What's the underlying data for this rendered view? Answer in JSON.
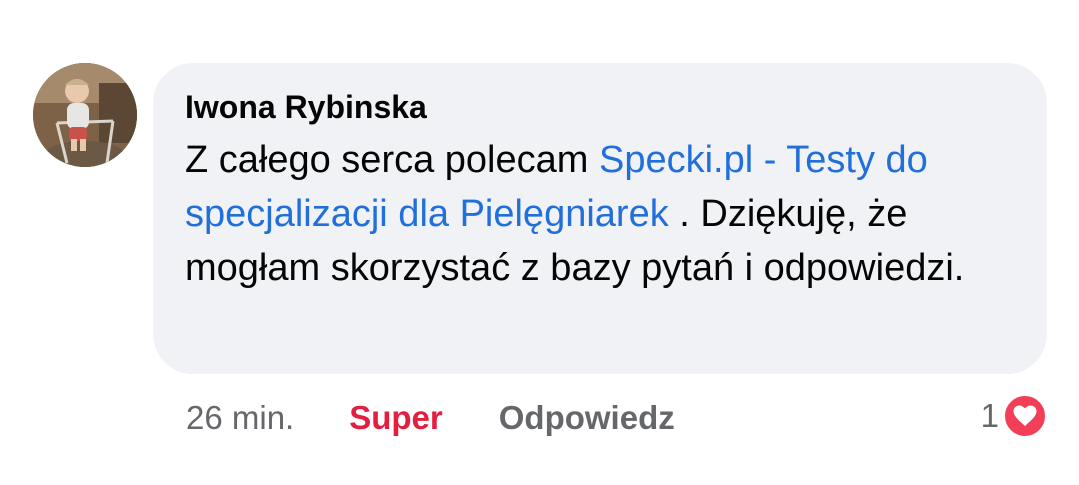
{
  "comment": {
    "author": "Iwona Rybinska",
    "text_before_link": "Z całego serca polecam ",
    "link_text": "Specki.pl - Testy do specjalizacji dla Pielęgniarek",
    "text_after_link": "  . Dziękuję, że mogłam skorzystać z bazy pytań i odpowiedzi."
  },
  "actions": {
    "time": "26 min.",
    "reaction_label": "Super",
    "reply_label": "Odpowiedz"
  },
  "reactions": {
    "count": "1",
    "icon": "heart-icon"
  },
  "colors": {
    "link": "#216fdb",
    "super": "#e41e3f",
    "bubble": "#f0f2f5",
    "heart": "#f33e58",
    "muted": "#65676b"
  }
}
